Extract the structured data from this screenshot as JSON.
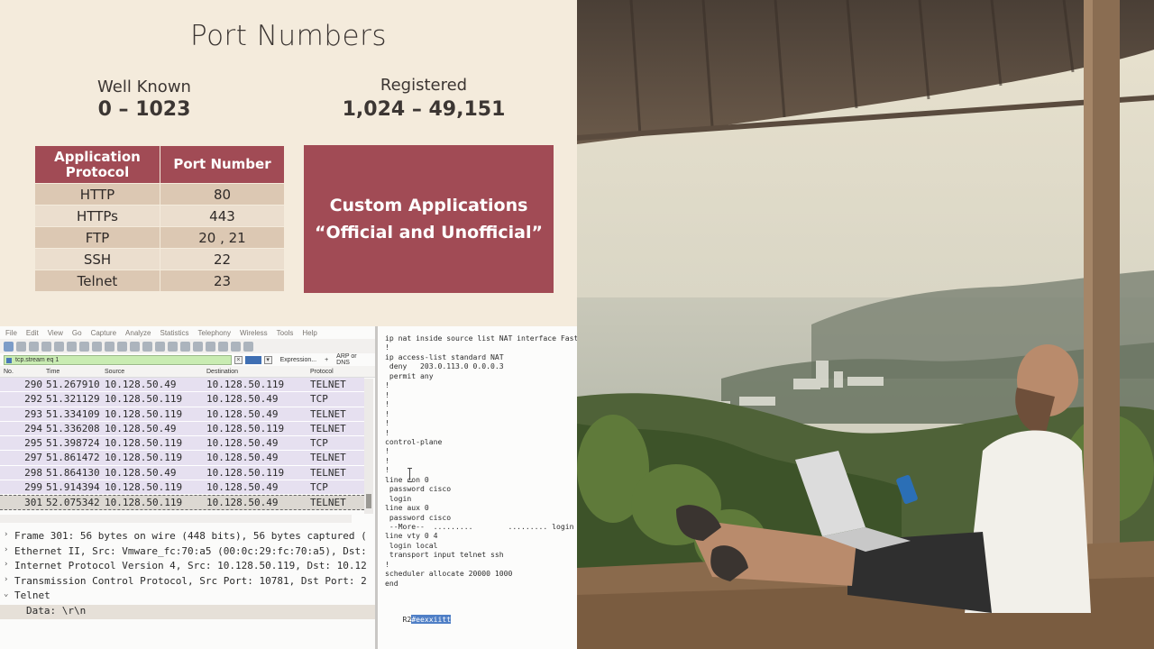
{
  "slide": {
    "title": "Port Numbers",
    "well_known": {
      "label": "Well Known",
      "range": "0 – 1023"
    },
    "registered": {
      "label": "Registered",
      "range": "1,024 – 49,151"
    },
    "table": {
      "headers": [
        "Application Protocol",
        "Port Number"
      ],
      "rows": [
        [
          "HTTP",
          "80"
        ],
        [
          "HTTPs",
          "443"
        ],
        [
          "FTP",
          "20 , 21"
        ],
        [
          "SSH",
          "22"
        ],
        [
          "Telnet",
          "23"
        ]
      ]
    },
    "custom_box": {
      "line1": "Custom Applications",
      "line2": "“Official and Unofficial”"
    }
  },
  "wireshark": {
    "menu": [
      "File",
      "Edit",
      "View",
      "Go",
      "Capture",
      "Analyze",
      "Statistics",
      "Telephony",
      "Wireless",
      "Tools",
      "Help"
    ],
    "filter": {
      "value": "tcp.stream eq 1",
      "expression_label": "Expression...",
      "plus": "+",
      "arp_label": "ARP or DNS"
    },
    "columns": {
      "no": "No.",
      "time": "Time",
      "source": "Source",
      "destination": "Destination",
      "protocol": "Protocol"
    },
    "packets": [
      {
        "no": "290",
        "time": "51.267910",
        "src": "10.128.50.49",
        "dst": "10.128.50.119",
        "proto": "TELNET"
      },
      {
        "no": "292",
        "time": "51.321129",
        "src": "10.128.50.119",
        "dst": "10.128.50.49",
        "proto": "TCP"
      },
      {
        "no": "293",
        "time": "51.334109",
        "src": "10.128.50.119",
        "dst": "10.128.50.49",
        "proto": "TELNET"
      },
      {
        "no": "294",
        "time": "51.336208",
        "src": "10.128.50.49",
        "dst": "10.128.50.119",
        "proto": "TELNET"
      },
      {
        "no": "295",
        "time": "51.398724",
        "src": "10.128.50.119",
        "dst": "10.128.50.49",
        "proto": "TCP"
      },
      {
        "no": "297",
        "time": "51.861472",
        "src": "10.128.50.119",
        "dst": "10.128.50.49",
        "proto": "TELNET"
      },
      {
        "no": "298",
        "time": "51.864130",
        "src": "10.128.50.49",
        "dst": "10.128.50.119",
        "proto": "TELNET"
      },
      {
        "no": "299",
        "time": "51.914394",
        "src": "10.128.50.119",
        "dst": "10.128.50.49",
        "proto": "TCP"
      },
      {
        "no": "301",
        "time": "52.075342",
        "src": "10.128.50.119",
        "dst": "10.128.50.49",
        "proto": "TELNET"
      }
    ],
    "details": [
      {
        "exp": "›",
        "text": "Frame 301: 56 bytes on wire (448 bits), 56 bytes captured ("
      },
      {
        "exp": "›",
        "text": "Ethernet II, Src: Vmware_fc:70:a5 (00:0c:29:fc:70:a5), Dst:"
      },
      {
        "exp": "›",
        "text": "Internet Protocol Version 4, Src: 10.128.50.119, Dst: 10.12"
      },
      {
        "exp": "›",
        "text": "Transmission Control Protocol, Src Port: 10781, Dst Port: 2"
      },
      {
        "exp": "⌄",
        "text": "Telnet"
      }
    ],
    "detail_child": "Data: \\r\\n"
  },
  "terminal": {
    "lines": [
      "ip nat inside source list NAT interface FastEt",
      "!",
      "ip access-list standard NAT",
      " deny   203.0.113.0 0.0.0.3",
      " permit any",
      "!",
      "!",
      "!",
      "!",
      "!",
      "!",
      "control-plane",
      "!",
      "!",
      "!",
      "line con 0",
      " password cisco",
      " login",
      "line aux 0",
      " password cisco",
      " --More--  .........        ......... login",
      "line vty 0 4",
      " login local",
      " transport input telnet ssh",
      "!",
      "scheduler allocate 20000 1000",
      "end",
      ""
    ],
    "prompt": "R2",
    "selected_input": "#eexxiitt"
  },
  "colors": {
    "slide_bg": "#f4ebdc",
    "accent": "#a14b55",
    "row_odd": "#dcc8b3",
    "row_even": "#ebdece",
    "packet_row": "#e6e0f0",
    "filter_green": "#c9ecb2"
  }
}
